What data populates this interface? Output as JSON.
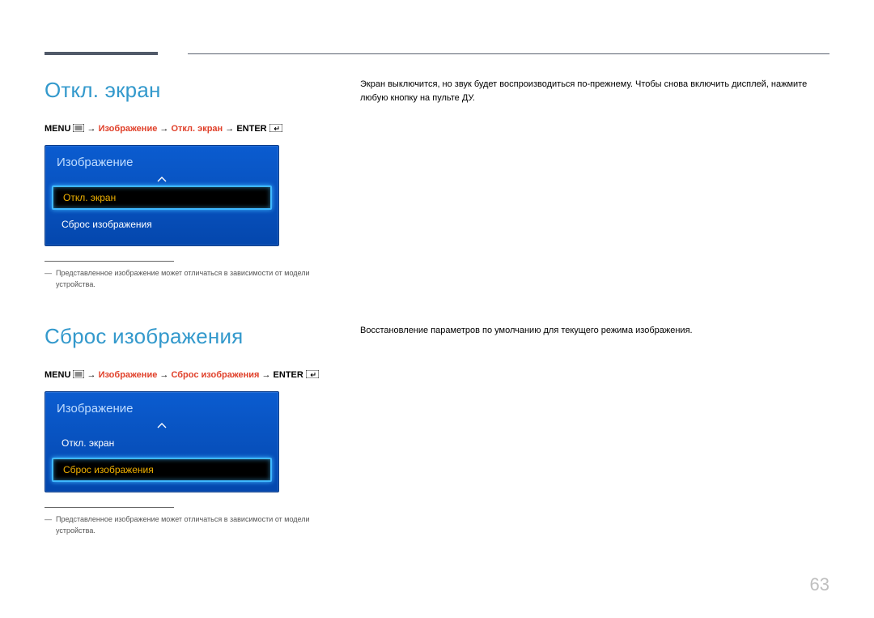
{
  "page_number": "63",
  "section1": {
    "heading": "Откл. экран",
    "description": "Экран выключится, но звук будет воспроизводиться по-прежнему. Чтобы снова включить дисплей, нажмите любую кнопку на пульте ДУ.",
    "nav": {
      "menu": "MENU",
      "arrow": " → ",
      "p1": "Изображение",
      "p2": "Откл. экран",
      "enter": "ENTER"
    },
    "osd": {
      "title": "Изображение",
      "item1": "Откл. экран",
      "item2": "Сброс изображения"
    },
    "note": "Представленное изображение может отличаться в зависимости от модели устройства."
  },
  "section2": {
    "heading": "Сброс изображения",
    "description": "Восстановление параметров по умолчанию для текущего режима изображения.",
    "nav": {
      "menu": "MENU",
      "arrow": " → ",
      "p1": "Изображение",
      "p2": "Сброс изображения",
      "enter": "ENTER"
    },
    "osd": {
      "title": "Изображение",
      "item1": "Откл. экран",
      "item2": "Сброс изображения"
    },
    "note": "Представленное изображение может отличаться в зависимости от модели устройства."
  }
}
